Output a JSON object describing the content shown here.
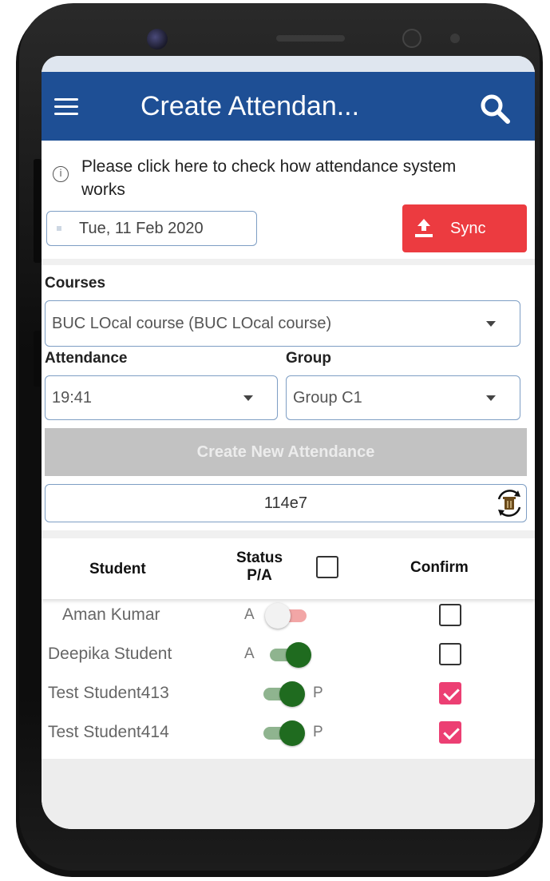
{
  "app_bar": {
    "title": "Create Attendan...",
    "menu_icon": "hamburger-menu-icon",
    "search_icon": "search-icon",
    "color": "#1e4f95"
  },
  "info": {
    "text": "Please click here to check how attendance system works",
    "icon": "info-icon"
  },
  "date_field": {
    "value": "Tue, 11 Feb 2020"
  },
  "sync_button": {
    "label": "Sync",
    "icon": "upload-icon",
    "color": "#ec3b40"
  },
  "courses": {
    "label": "Courses",
    "selected": "BUC LOcal course (BUC LOcal course)"
  },
  "attendance": {
    "label": "Attendance",
    "selected": "19:41"
  },
  "group": {
    "label": "Group",
    "selected": "Group C1"
  },
  "create_button": {
    "label": "Create New Attendance"
  },
  "code_field": {
    "value": "114e7",
    "icon": "delete-refresh-icon"
  },
  "table": {
    "headers": {
      "student": "Student",
      "status_line1": "Status",
      "status_line2": "P/A",
      "confirm": "Confirm"
    },
    "select_all_checked": false,
    "rows": [
      {
        "name": "Aman Kumar",
        "status": "A",
        "present": false,
        "confirmed": false
      },
      {
        "name": "Deepika Student",
        "status": "A",
        "present": true,
        "confirmed": false
      },
      {
        "name": "Test Student413",
        "status": "P",
        "present": true,
        "confirmed": true
      },
      {
        "name": "Test Student414",
        "status": "P",
        "present": true,
        "confirmed": true
      }
    ]
  },
  "colors": {
    "toggle_on": "#1f6b1f",
    "toggle_off_track": "#f2a6a6",
    "confirm_checked": "#ec3f73",
    "disabled_button": "#c2c2c2"
  }
}
